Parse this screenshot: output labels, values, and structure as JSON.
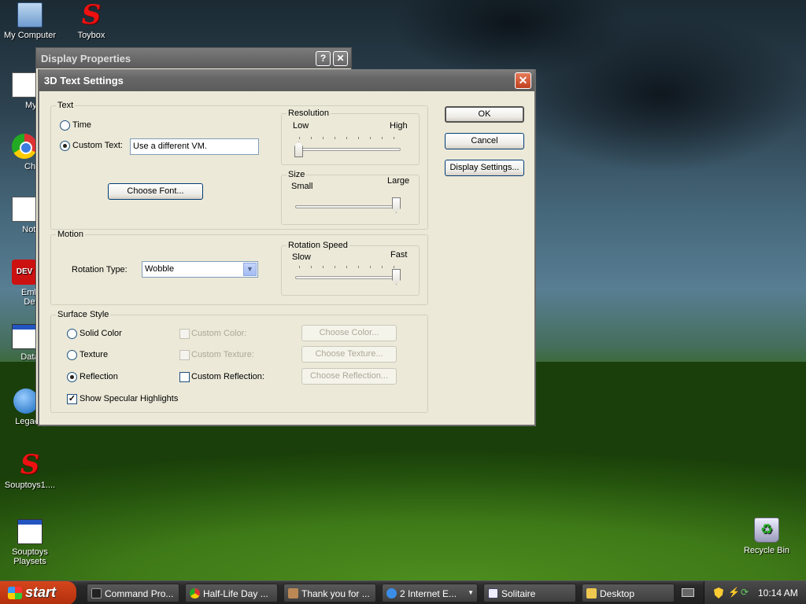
{
  "desktop": {
    "icons": [
      {
        "label": "My Computer"
      },
      {
        "label": "Toybox"
      },
      {
        "label": "MyPa"
      },
      {
        "label": "Chron"
      },
      {
        "label": "Notepa"
      },
      {
        "label": "Embarc"
      },
      {
        "label": "Dev-C"
      },
      {
        "label": "DataWa"
      },
      {
        "label": "LegacyUp"
      },
      {
        "label": "Souptoys1...."
      },
      {
        "label": "Souptoys"
      },
      {
        "label": "Playsets"
      },
      {
        "label": "Recycle Bin"
      }
    ]
  },
  "back_window": {
    "title": "Display Properties",
    "help": "?",
    "close": "✕"
  },
  "dialog": {
    "title": "3D Text Settings",
    "close": "✕",
    "text_group": {
      "label": "Text",
      "time_label": "Time",
      "custom_label": "Custom Text:",
      "custom_value": "Use a different VM.",
      "choose_font": "Choose Font..."
    },
    "resolution": {
      "label": "Resolution",
      "low": "Low",
      "high": "High",
      "level": 0.0
    },
    "size": {
      "label": "Size",
      "small": "Small",
      "large": "Large",
      "level": 1.0
    },
    "motion": {
      "label": "Motion",
      "rotation_type_label": "Rotation Type:",
      "rotation_type_value": "Wobble"
    },
    "rotation_speed": {
      "label": "Rotation Speed",
      "slow": "Slow",
      "fast": "Fast",
      "level": 1.0
    },
    "surface": {
      "label": "Surface Style",
      "solid": "Solid Color",
      "texture": "Texture",
      "reflection": "Reflection",
      "custom_color": "Custom Color:",
      "custom_texture": "Custom Texture:",
      "custom_reflection": "Custom Reflection:",
      "choose_color": "Choose Color...",
      "choose_texture": "Choose Texture...",
      "choose_reflection": "Choose Reflection...",
      "specular": "Show Specular Highlights"
    },
    "buttons": {
      "ok": "OK",
      "cancel": "Cancel",
      "display_settings": "Display Settings..."
    }
  },
  "taskbar": {
    "start": "start",
    "tasks": [
      {
        "label": "Command Pro..."
      },
      {
        "label": "Half-Life Day ..."
      },
      {
        "label": "Thank you for ..."
      },
      {
        "label": "2 Internet E..."
      },
      {
        "label": "Solitaire"
      },
      {
        "label": "Desktop"
      }
    ],
    "clock": "10:14 AM"
  }
}
